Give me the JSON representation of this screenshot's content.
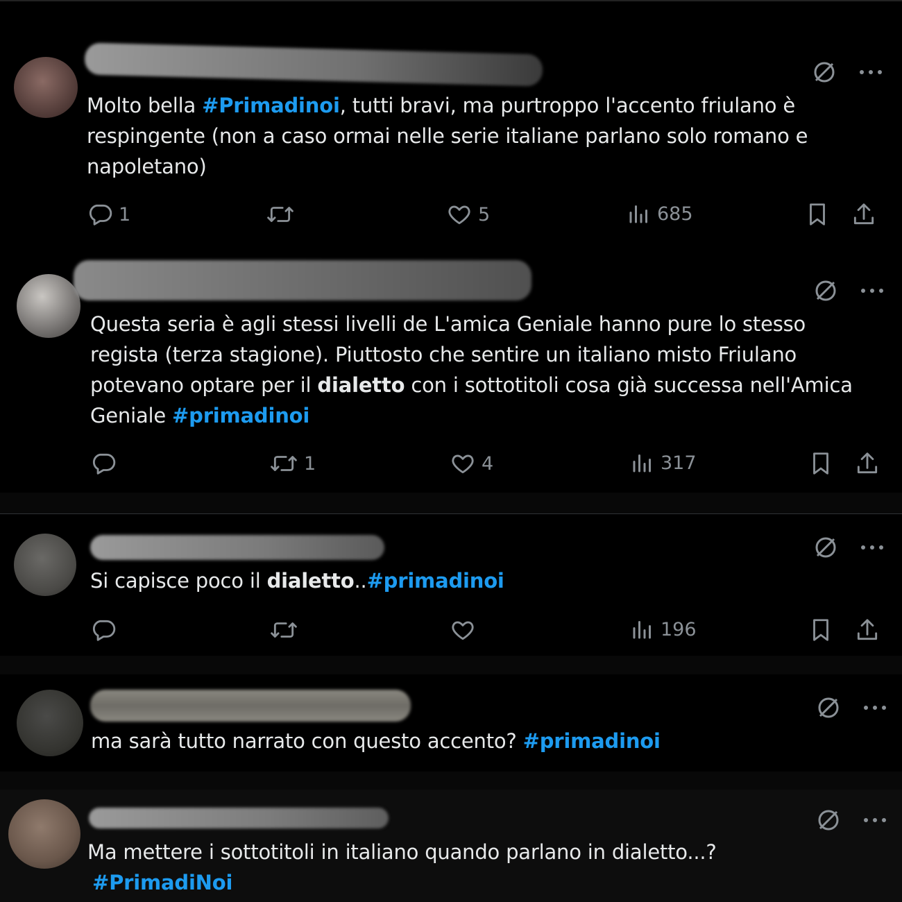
{
  "posts": [
    {
      "text_parts": [
        "Molto bella ",
        "#Primadinoi",
        ", tutti bravi, ma purtroppo l'accento friulano è",
        "respingente (non a caso ormai nelle serie italiane parlano solo romano e",
        "napoletano)"
      ],
      "replies": "1",
      "reposts": "",
      "likes": "5",
      "views": "685"
    },
    {
      "text_parts": [
        "Questa seria è agli stessi livelli de L'amica Geniale hanno pure lo stesso",
        "regista (terza stagione). Piuttosto che sentire un italiano misto Friulano",
        "potevano optare per il ",
        "dialetto",
        " con i sottotitoli cosa già successa nell'Amica",
        "Geniale ",
        "#primadinoi"
      ],
      "replies": "",
      "reposts": "1",
      "likes": "4",
      "views": "317"
    },
    {
      "text_parts": [
        "Si capisce poco il ",
        "dialetto",
        "..",
        "#primadinoi"
      ],
      "replies": "",
      "reposts": "",
      "likes": "",
      "views": "196"
    },
    {
      "text_parts": [
        "ma sarà tutto narrato con questo accento? ",
        "#primadinoi"
      ]
    },
    {
      "text_parts": [
        "Ma mettere i sottotitoli in italiano quando parlano in dialetto...?",
        "#PrimadiNoi"
      ]
    }
  ],
  "icons": {
    "reply": "speech-bubble-icon",
    "repost": "repost-arrows-icon",
    "like": "heart-icon",
    "views": "bar-chart-icon",
    "bookmark": "bookmark-icon",
    "share": "share-upload-icon",
    "grok": "slashed-circle-icon",
    "more": "more-dots-icon"
  },
  "colors": {
    "hashtag": "#1d9bf0",
    "text": "#e7e9ea",
    "muted": "#8b9197",
    "background": "#000000"
  }
}
